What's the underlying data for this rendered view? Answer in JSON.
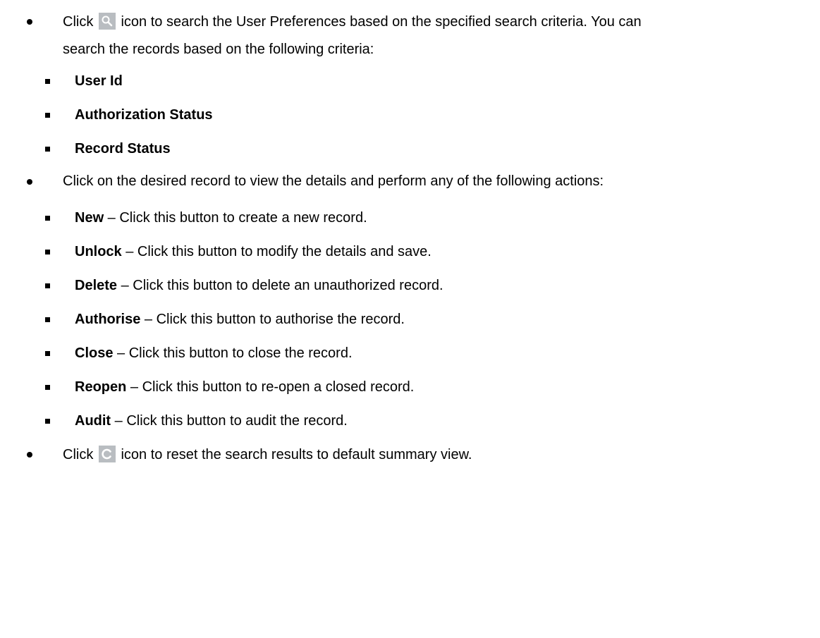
{
  "intro": {
    "click_word": "Click",
    "search_icon": "search-icon",
    "rest_line1": "icon to search the User Preferences based on the specified search criteria. You can",
    "line2": "search the records based on the following criteria:"
  },
  "criteria": [
    "User Id",
    "Authorization Status",
    "Record Status"
  ],
  "actions_intro": "Click on the desired record to view the details and perform any of the following actions:",
  "actions": [
    {
      "name": "New",
      "desc": " – Click this button to create a new record."
    },
    {
      "name": "Unlock",
      "desc": " – Click this button to modify the details and save."
    },
    {
      "name": "Delete",
      "desc": " – Click this button to delete an unauthorized record."
    },
    {
      "name": "Authorise",
      "desc": " – Click this button to authorise the record."
    },
    {
      "name": "Close",
      "desc": " – Click this button to close the record."
    },
    {
      "name": "Reopen",
      "desc": " – Click this button to re-open a closed record."
    },
    {
      "name": "Audit",
      "desc": " – Click this button to audit the record."
    }
  ],
  "reset": {
    "click_word": "Click",
    "reset_icon": "reset-icon",
    "rest": "icon to reset the search results to default summary view."
  },
  "colors": {
    "icon_bg": "#b9bdc1",
    "text": "#000000"
  }
}
